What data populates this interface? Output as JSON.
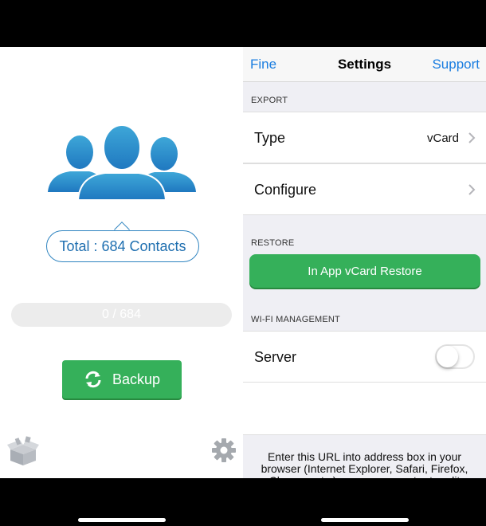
{
  "left": {
    "total_label": "Total : 684 Contacts",
    "progress_text": "0 / 684",
    "progress_fraction": 0,
    "backup_label": "Backup"
  },
  "right": {
    "nav": {
      "left": "Fine",
      "title": "Settings",
      "right": "Support"
    },
    "export_header": "EXPORT",
    "type_label": "Type",
    "type_value": "vCard",
    "configure_label": "Configure",
    "restore_header": "RESTORE",
    "restore_button": "In App vCard Restore",
    "wifi_header": "WI-FI MANAGEMENT",
    "server_label": "Server",
    "server_enabled": false,
    "footer_text": "Enter this URL into address box in your browser (Internet Explorer, Safari, Firefox, Chrome, etc.) on your computer to edit"
  },
  "colors": {
    "accent_blue": "#1a7de0",
    "green": "#35b05a",
    "contacts_blue": "#2f84c0"
  }
}
